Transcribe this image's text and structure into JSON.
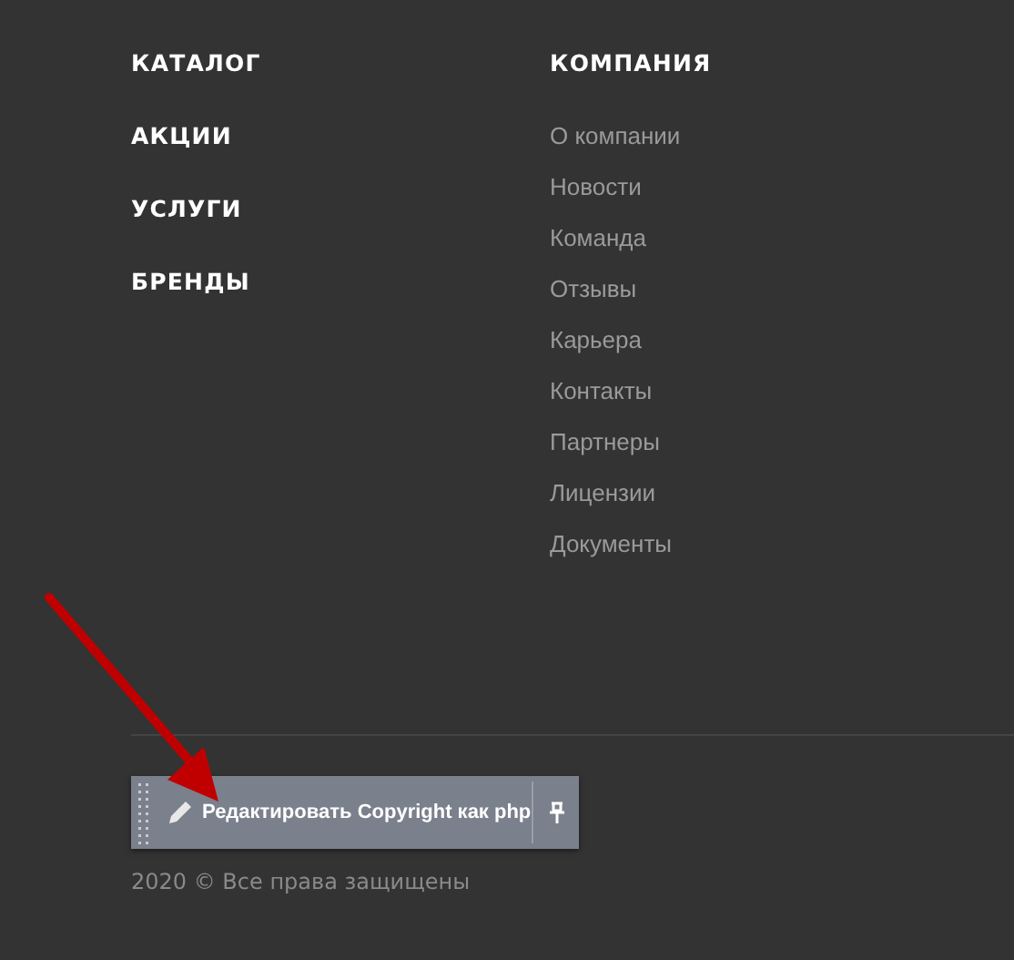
{
  "main_menu": [
    "КАТАЛОГ",
    "АКЦИИ",
    "УСЛУГИ",
    "БРЕНДЫ"
  ],
  "company": {
    "title": "КОМПАНИЯ",
    "links": [
      "О компании",
      "Новости",
      "Команда",
      "Отзывы",
      "Карьера",
      "Контакты",
      "Партнеры",
      "Лицензии",
      "Документы"
    ]
  },
  "edit_toolbar": {
    "label": "Редактировать Copyright как php"
  },
  "copyright": "2020 © Все права защищены"
}
